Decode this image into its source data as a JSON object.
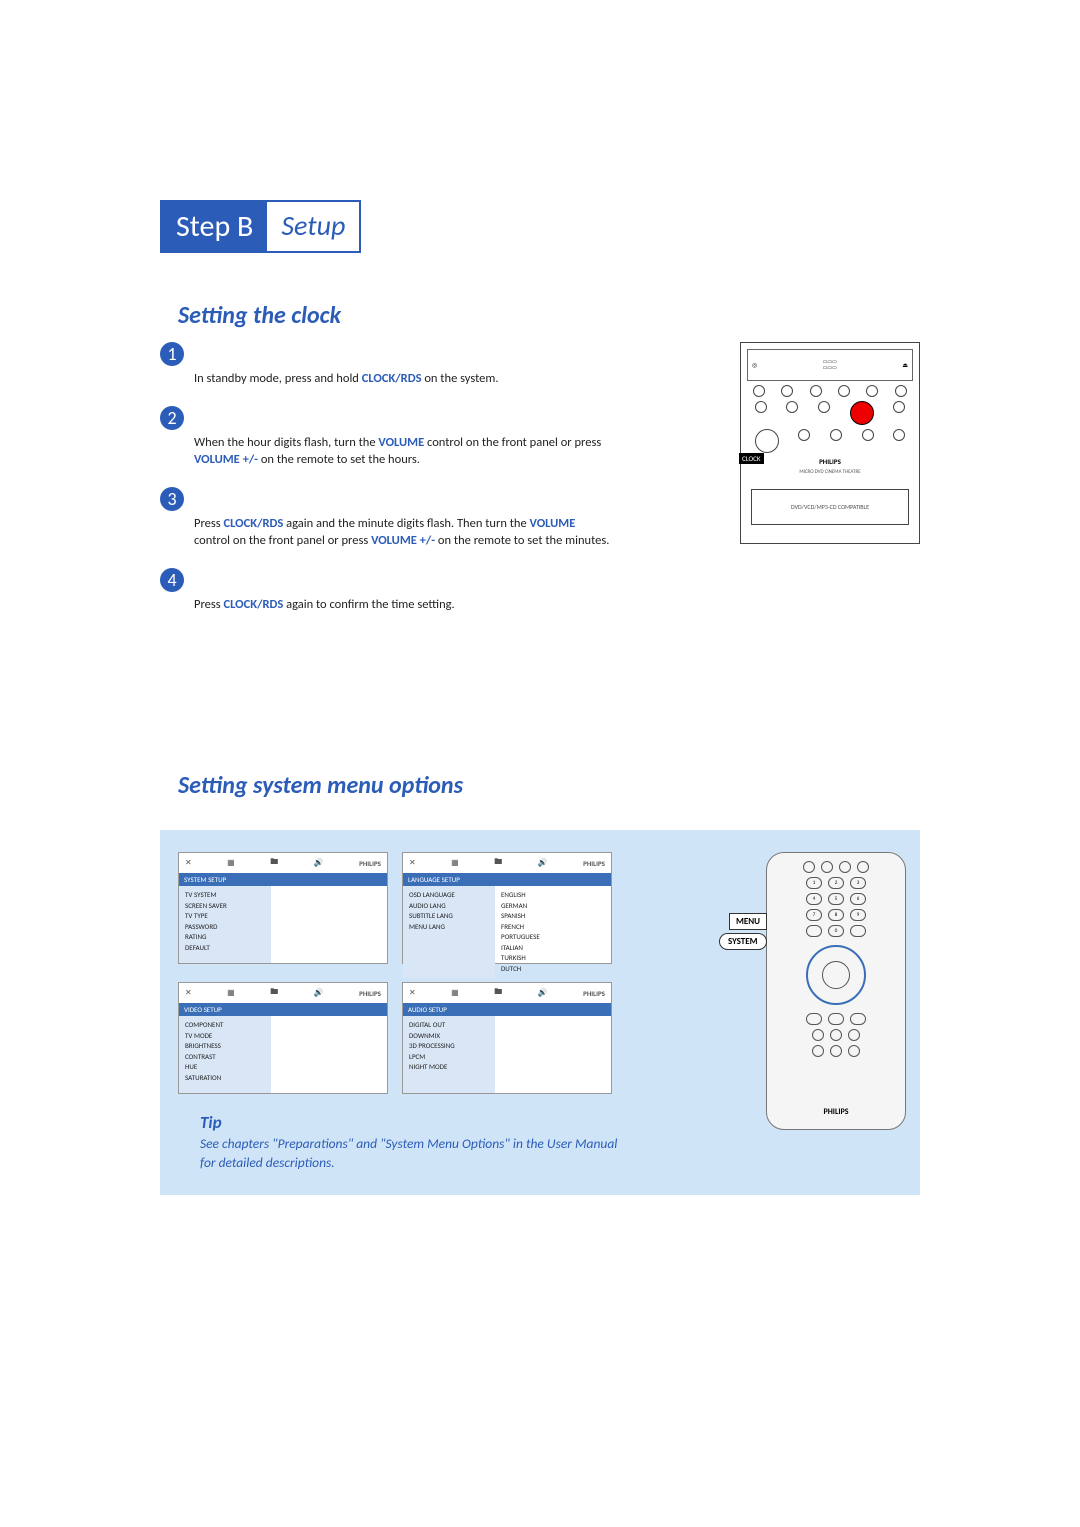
{
  "step_header": {
    "label": "Step B",
    "name": "Setup"
  },
  "section1_title": "Setting the clock",
  "clock_steps": {
    "s1": {
      "num": "1",
      "pre": "In standby mode, press and hold ",
      "kw1": "CLOCK/RDS",
      "post": " on the system."
    },
    "s2": {
      "num": "2",
      "pre": "When the hour digits flash, turn the ",
      "kw1": "VOLUME",
      "mid": " control on the front panel or press ",
      "kw2": "VOLUME +/-",
      "post": " on the remote to set the hours."
    },
    "s3": {
      "num": "3",
      "pre": "Press ",
      "kw1": "CLOCK/RDS",
      "mid": " again and the minute digits flash. Then turn the ",
      "kw2": "VOLUME",
      "mid2": " control on the front panel or press ",
      "kw3": "VOLUME +/-",
      "post": " on the remote to set the minutes."
    },
    "s4": {
      "num": "4",
      "pre": "Press ",
      "kw1": "CLOCK/RDS",
      "post": " again to confirm the time setting."
    }
  },
  "device": {
    "clock_label": "CLOCK",
    "brand": "PHILIPS",
    "subtitle": "MICRO DVD CINEMA THEATRE",
    "cd_text": "DVD/VCD/MP3-CD COMPATIBLE"
  },
  "section2_title": "Setting system menu options",
  "screens": {
    "s1": {
      "title": "SYSTEM SETUP",
      "items": [
        "TV SYSTEM",
        "SCREEN SAVER",
        "TV TYPE",
        "PASSWORD",
        "RATING",
        "DEFAULT"
      ],
      "brand": "PHILIPS"
    },
    "s2": {
      "title": "LANGUAGE SETUP",
      "items": [
        "OSD LANGUAGE",
        "AUDIO LANG",
        "SUBTITLE LANG",
        "MENU LANG"
      ],
      "langs": [
        "ENGLISH",
        "GERMAN",
        "SPANISH",
        "FRENCH",
        "PORTUGUESE",
        "ITALIAN",
        "TURKISH",
        "DUTCH"
      ],
      "brand": "PHILIPS"
    },
    "s3": {
      "title": "VIDEO SETUP",
      "items": [
        "COMPONENT",
        "TV MODE",
        "BRIGHTNESS",
        "CONTRAST",
        "HUE",
        "SATURATION"
      ],
      "brand": "PHILIPS"
    },
    "s4": {
      "title": "AUDIO SETUP",
      "items": [
        "DIGITAL OUT",
        "DOWNMIX",
        "3D PROCESSING",
        "LPCM",
        "NIGHT MODE"
      ],
      "brand": "PHILIPS"
    }
  },
  "remote": {
    "brand": "PHILIPS",
    "callout_menu": "MENU",
    "callout_system": "SYSTEM",
    "numpad": [
      "1",
      "2",
      "3",
      "4",
      "5",
      "6",
      "7",
      "8",
      "9",
      "0"
    ]
  },
  "tip": {
    "title": "Tip",
    "text": "See chapters \"Preparations\" and \"System Menu Options\" in the User Manual for detailed descriptions."
  }
}
